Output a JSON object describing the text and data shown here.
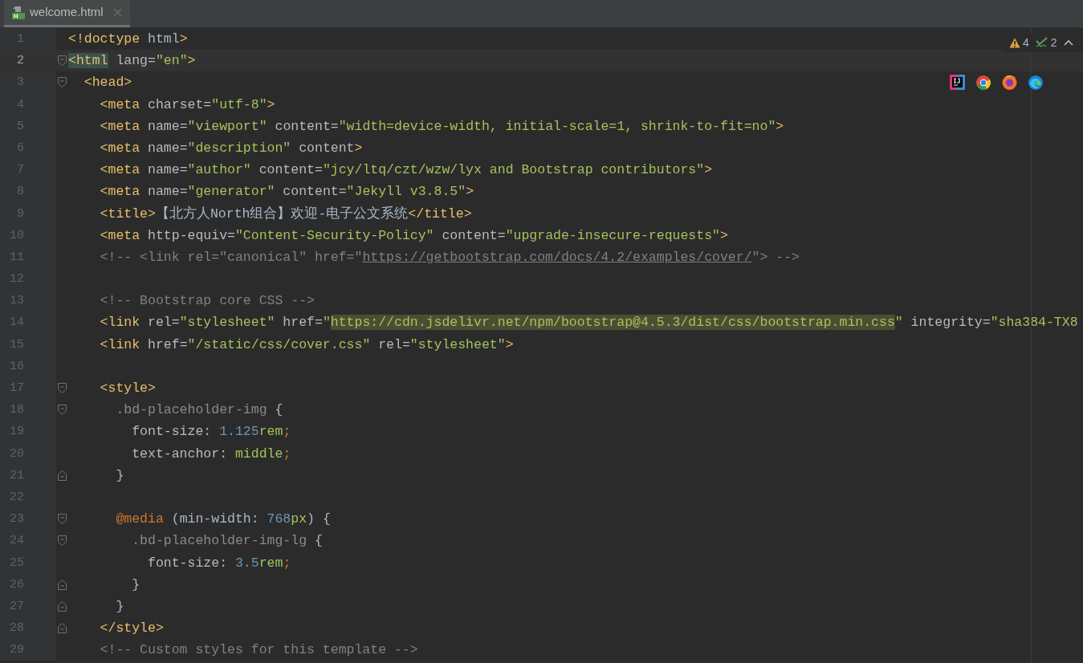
{
  "tab": {
    "label": "welcome.html",
    "selected": true
  },
  "inspections": [
    {
      "kind": "warning",
      "count": "4"
    },
    {
      "kind": "check",
      "count": "2"
    }
  ],
  "lines": [
    {
      "number": "1",
      "current": false,
      "kind": "plain",
      "tokens": [
        {
          "kind": "tag",
          "text": "<!doctype"
        },
        {
          "kind": "text",
          "text": " html"
        },
        {
          "kind": "tag",
          "text": ">"
        }
      ]
    },
    {
      "number": "2",
      "current": true,
      "kind": "fold_start",
      "tokens": [
        {
          "kind": "tagmatch",
          "text": "<html"
        },
        {
          "kind": "attr",
          "text": " lang="
        },
        {
          "kind": "str",
          "text": "\"en\""
        },
        {
          "kind": "tag",
          "text": ">"
        }
      ]
    },
    {
      "number": "3",
      "current": false,
      "kind": "fold_start",
      "tokens": [
        {
          "kind": "tag",
          "text": "  <head>"
        }
      ]
    },
    {
      "number": "4",
      "current": false,
      "kind": "plain",
      "tokens": [
        {
          "kind": "tag",
          "text": "    <meta"
        },
        {
          "kind": "attr",
          "text": " charset="
        },
        {
          "kind": "str",
          "text": "\"utf-8\""
        },
        {
          "kind": "tag",
          "text": ">"
        }
      ]
    },
    {
      "number": "5",
      "current": false,
      "kind": "plain",
      "tokens": [
        {
          "kind": "tag",
          "text": "    <meta"
        },
        {
          "kind": "attr",
          "text": " name="
        },
        {
          "kind": "str",
          "text": "\"viewport\""
        },
        {
          "kind": "attr",
          "text": " content="
        },
        {
          "kind": "str",
          "text": "\"width=device-width, initial-scale=1, shrink-to-fit=no\""
        },
        {
          "kind": "tag",
          "text": ">"
        }
      ]
    },
    {
      "number": "6",
      "current": false,
      "kind": "plain",
      "tokens": [
        {
          "kind": "tag",
          "text": "    <meta"
        },
        {
          "kind": "attr",
          "text": " name="
        },
        {
          "kind": "str",
          "text": "\"description\""
        },
        {
          "kind": "attr",
          "text": " content"
        },
        {
          "kind": "tag",
          "text": ">"
        }
      ]
    },
    {
      "number": "7",
      "current": false,
      "kind": "plain",
      "tokens": [
        {
          "kind": "tag",
          "text": "    <meta"
        },
        {
          "kind": "attr",
          "text": " name="
        },
        {
          "kind": "str",
          "text": "\"author\""
        },
        {
          "kind": "attr",
          "text": " content="
        },
        {
          "kind": "str",
          "text": "\"jcy/ltq/czt/wzw/lyx and Bootstrap contributors\""
        },
        {
          "kind": "tag",
          "text": ">"
        }
      ]
    },
    {
      "number": "8",
      "current": false,
      "kind": "plain",
      "tokens": [
        {
          "kind": "tag",
          "text": "    <meta"
        },
        {
          "kind": "attr",
          "text": " name="
        },
        {
          "kind": "str",
          "text": "\"generator\""
        },
        {
          "kind": "attr",
          "text": " content="
        },
        {
          "kind": "str",
          "text": "\"Jekyll v3.8.5\""
        },
        {
          "kind": "tag",
          "text": ">"
        }
      ]
    },
    {
      "number": "9",
      "current": false,
      "kind": "plain",
      "tokens": [
        {
          "kind": "tag",
          "text": "    <title>"
        },
        {
          "kind": "text",
          "text": "【北方人North组合】欢迎-电子公文系统"
        },
        {
          "kind": "tag",
          "text": "</title>"
        }
      ]
    },
    {
      "number": "10",
      "current": false,
      "kind": "plain",
      "tokens": [
        {
          "kind": "tag",
          "text": "    <meta"
        },
        {
          "kind": "attr",
          "text": " http-equiv="
        },
        {
          "kind": "str",
          "text": "\"Content-Security-Policy\""
        },
        {
          "kind": "attr",
          "text": " content="
        },
        {
          "kind": "str",
          "text": "\"upgrade-insecure-requests\""
        },
        {
          "kind": "tag",
          "text": ">"
        }
      ]
    },
    {
      "number": "11",
      "current": false,
      "kind": "plain",
      "tokens": [
        {
          "kind": "comment",
          "text": "    <!-- <link rel=\"canonical\" href=\""
        },
        {
          "kind": "url",
          "text": "https://getbootstrap.com/docs/4.2/examples/cover/"
        },
        {
          "kind": "comment",
          "text": "\"> -->"
        }
      ]
    },
    {
      "number": "12",
      "current": false,
      "kind": "plain"
    },
    {
      "number": "13",
      "current": false,
      "kind": "plain",
      "tokens": [
        {
          "kind": "comment",
          "text": "    <!-- Bootstrap core CSS -->"
        }
      ]
    },
    {
      "number": "14",
      "current": false,
      "kind": "plain",
      "tokens": [
        {
          "kind": "tag",
          "text": "    <link"
        },
        {
          "kind": "attr",
          "text": " rel="
        },
        {
          "kind": "str",
          "text": "\"stylesheet\""
        },
        {
          "kind": "attr",
          "text": " href="
        },
        {
          "kind": "str",
          "text": "\""
        },
        {
          "kind": "strhl",
          "text": "https://cdn.jsdelivr.net/npm/bootstrap@4.5.3/dist/css/bootstrap.min.css"
        },
        {
          "kind": "str",
          "text": "\""
        },
        {
          "kind": "attr",
          "text": " integrity="
        },
        {
          "kind": "str",
          "text": "\"sha384-TX8"
        }
      ]
    },
    {
      "number": "15",
      "current": false,
      "kind": "plain",
      "tokens": [
        {
          "kind": "tag",
          "text": "    <link"
        },
        {
          "kind": "attr",
          "text": " href="
        },
        {
          "kind": "str",
          "text": "\"/static/css/cover.css\""
        },
        {
          "kind": "attr",
          "text": " rel="
        },
        {
          "kind": "str",
          "text": "\"stylesheet\""
        },
        {
          "kind": "tag",
          "text": ">"
        }
      ]
    },
    {
      "number": "16",
      "current": false,
      "kind": "plain"
    },
    {
      "number": "17",
      "current": false,
      "kind": "fold_start",
      "tokens": [
        {
          "kind": "tag",
          "text": "    <style>"
        }
      ]
    },
    {
      "number": "18",
      "current": false,
      "kind": "fold_start",
      "tokens": [
        {
          "kind": "sel",
          "text": "      .bd-placeholder-img"
        },
        {
          "kind": "text",
          "text": " {"
        }
      ]
    },
    {
      "number": "19",
      "current": false,
      "kind": "plain",
      "tokens": [
        {
          "kind": "attr",
          "text": "        font-size"
        },
        {
          "kind": "text",
          "text": ": "
        },
        {
          "kind": "num",
          "text": "1.125"
        },
        {
          "kind": "str",
          "text": "rem"
        },
        {
          "kind": "semi",
          "text": ";"
        }
      ]
    },
    {
      "number": "20",
      "current": false,
      "kind": "plain",
      "tokens": [
        {
          "kind": "attr",
          "text": "        text-anchor"
        },
        {
          "kind": "text",
          "text": ": "
        },
        {
          "kind": "str",
          "text": "middle"
        },
        {
          "kind": "semi",
          "text": ";"
        }
      ]
    },
    {
      "number": "21",
      "current": false,
      "kind": "fold_end",
      "tokens": [
        {
          "kind": "text",
          "text": "      }"
        }
      ]
    },
    {
      "number": "22",
      "current": false,
      "kind": "plain"
    },
    {
      "number": "23",
      "current": false,
      "kind": "fold_start",
      "tokens": [
        {
          "kind": "kw",
          "text": "      @media"
        },
        {
          "kind": "text",
          "text": " (min-width: "
        },
        {
          "kind": "num",
          "text": "768"
        },
        {
          "kind": "str",
          "text": "px"
        },
        {
          "kind": "text",
          "text": ") {"
        }
      ]
    },
    {
      "number": "24",
      "current": false,
      "kind": "fold_start",
      "tokens": [
        {
          "kind": "sel",
          "text": "        .bd-placeholder-img-lg"
        },
        {
          "kind": "text",
          "text": " {"
        }
      ]
    },
    {
      "number": "25",
      "current": false,
      "kind": "plain",
      "tokens": [
        {
          "kind": "attr",
          "text": "          font-size"
        },
        {
          "kind": "text",
          "text": ": "
        },
        {
          "kind": "num",
          "text": "3.5"
        },
        {
          "kind": "str",
          "text": "rem"
        },
        {
          "kind": "semi",
          "text": ";"
        }
      ]
    },
    {
      "number": "26",
      "current": false,
      "kind": "fold_end",
      "tokens": [
        {
          "kind": "text",
          "text": "        }"
        }
      ]
    },
    {
      "number": "27",
      "current": false,
      "kind": "fold_end",
      "tokens": [
        {
          "kind": "text",
          "text": "      }"
        }
      ]
    },
    {
      "number": "28",
      "current": false,
      "kind": "fold_end",
      "tokens": [
        {
          "kind": "tag",
          "text": "    </style>"
        }
      ]
    },
    {
      "number": "29",
      "current": false,
      "kind": "plain",
      "tokens": [
        {
          "kind": "comment",
          "text": "    <!-- Custom styles for this template -->"
        }
      ]
    }
  ]
}
